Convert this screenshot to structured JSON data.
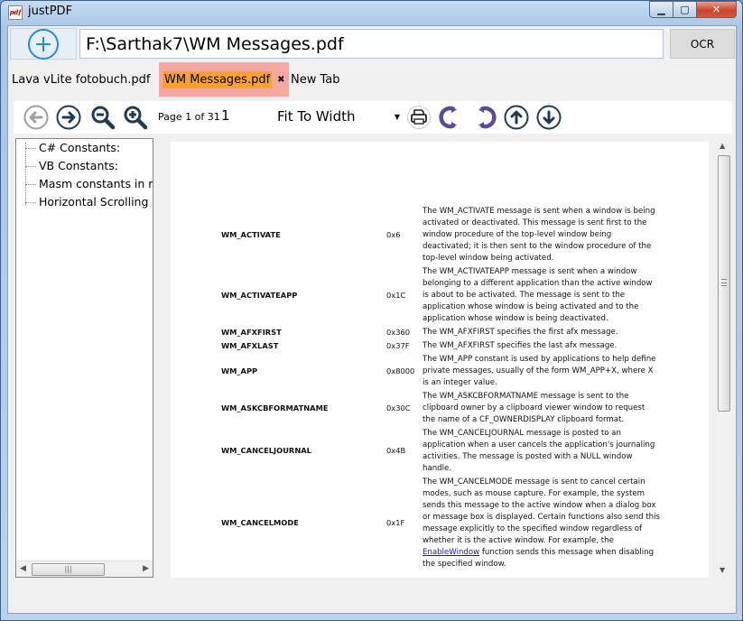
{
  "window": {
    "title": "justPDF",
    "icon": "pdf-icon"
  },
  "address": {
    "path": "F:\\Sarthak7\\WM Messages.pdf",
    "ocr_label": "OCR"
  },
  "tabs": [
    {
      "label": "Lava vLite fotobuch.pdf",
      "active": false
    },
    {
      "label": "WM Messages.pdf",
      "active": true,
      "close": "✖"
    },
    {
      "label": "New Tab",
      "active": false
    }
  ],
  "toolbar": {
    "page_label": "Page 1 of 31",
    "page_input": "1",
    "zoom_value": "Fit To Width"
  },
  "outline": {
    "items": [
      "C# Constants:",
      "VB Constants:",
      "Masm constants in nu",
      "Horizontal Scrolling S"
    ]
  },
  "messages": [
    {
      "name": "WM_ACTIVATE",
      "value": "0x6",
      "desc": [
        "The WM_ACTIVATE message is sent when a window is being",
        "activated or deactivated. This message is sent first to the",
        "window procedure of the top-level window being",
        "deactivated; it is then sent to the window procedure of the",
        "top-level window being activated."
      ]
    },
    {
      "name": "WM_ACTIVATEAPP",
      "value": "0x1C",
      "desc": [
        "The WM_ACTIVATEAPP message is sent when a window",
        "belonging to a different application than the active window",
        "is about to be activated. The message is sent to the",
        "application whose window is being activated and to the",
        "application whose window is being deactivated."
      ]
    },
    {
      "name": "WM_AFXFIRST",
      "value": "0x360",
      "desc": [
        "The WM_AFXFIRST specifies the first afx message."
      ]
    },
    {
      "name": "WM_AFXLAST",
      "value": "0x37F",
      "desc": [
        "The WM_AFXFIRST specifies the last afx message."
      ]
    },
    {
      "name": "WM_APP",
      "value": "0x8000",
      "desc": [
        "The WM_APP constant is used by applications to help define",
        "private messages, usually of the form WM_APP+X, where X",
        "is an integer value."
      ]
    },
    {
      "name": "WM_ASKCBFORMATNAME",
      "value": "0x30C",
      "desc": [
        "The WM_ASKCBFORMATNAME message is sent to the",
        "clipboard owner by a clipboard viewer window to request",
        "the name of a CF_OWNERDISPLAY clipboard format."
      ]
    },
    {
      "name": "WM_CANCELJOURNAL",
      "value": "0x4B",
      "desc": [
        "The WM_CANCELJOURNAL message is posted to an",
        "application when a user cancels the application's journaling",
        "activities. The message is posted with a NULL window",
        "handle."
      ]
    },
    {
      "name": "WM_CANCELMODE",
      "value": "0x1F",
      "desc": [
        "The WM_CANCELMODE message is sent to cancel certain",
        "modes, such as mouse capture. For example, the system",
        "sends this message to the active window when a dialog box",
        "or message box is displayed. Certain functions also send this",
        "message explicitly to the specified window regardless of",
        "whether it is the active window. For example, the"
      ],
      "link": "EnableWindow",
      "desc_after_link": " function sends this message when disabling",
      "desc_last": "the specified window."
    }
  ],
  "colors": {
    "accent": "#1f8fd9",
    "tab_active": "#f9a22c",
    "tab_active_bg": "#f7a7a2",
    "nav_icon": "#1e3a55",
    "rotate_icon": "#5b4a9a"
  }
}
